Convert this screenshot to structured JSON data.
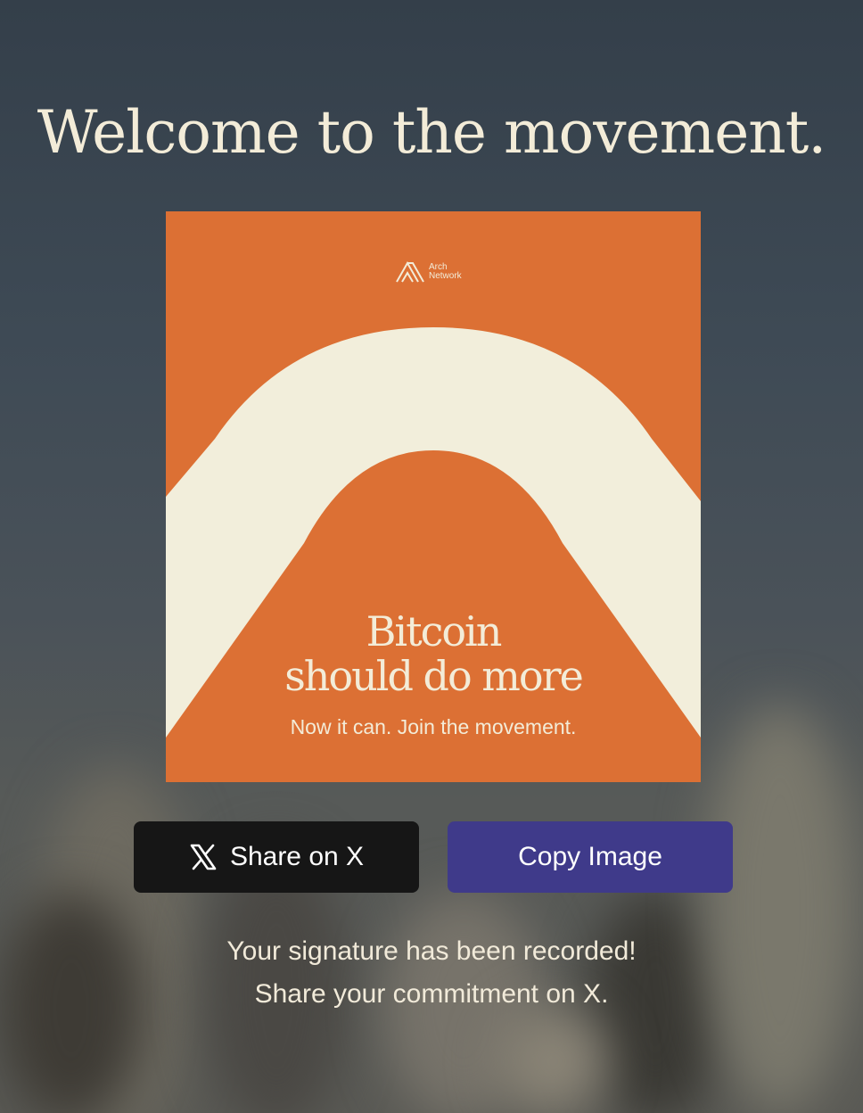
{
  "page": {
    "heading": "Welcome to the movement."
  },
  "card": {
    "logo_icon": "arch-network-logo-icon",
    "logo_line1": "Arch",
    "logo_line2": "Network",
    "title_line1": "Bitcoin",
    "title_line2": "should do more",
    "subtitle": "Now it can. Join the movement.",
    "colors": {
      "background": "#dc7034",
      "arch": "#f2eedb"
    }
  },
  "actions": {
    "share_x_icon": "x-logo-icon",
    "share_x_label": "Share on X",
    "copy_image_label": "Copy Image",
    "share_x_color": "#161616",
    "copy_image_color": "#3f3a8a"
  },
  "status": {
    "line1": "Your signature has been recorded!",
    "line2": "Share your commitment on X."
  }
}
